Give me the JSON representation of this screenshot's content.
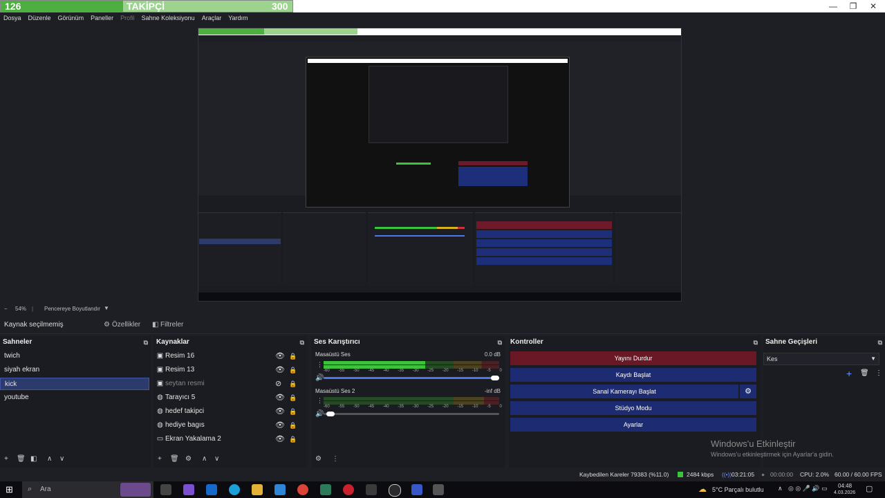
{
  "titlebar": {
    "follower_count": "126",
    "follower_label": "TAKİPÇİ",
    "follower_goal": "300",
    "follower_progress": 0.42,
    "minimize": "—",
    "maximize": "❐",
    "close": "✕"
  },
  "menu": [
    "Dosya",
    "Düzenle",
    "Görünüm",
    "Paneller",
    "Profil",
    "Sahne Koleksiyonu",
    "Araçlar",
    "Yardım"
  ],
  "zoom": {
    "minus": "−",
    "percent": "54%",
    "mode": "Pencereye Boyutlandır"
  },
  "source_toolbar": {
    "no_source": "Kaynak seçilmemiş",
    "properties": "Özellikler",
    "filters": "Filtreler"
  },
  "scenes": {
    "title": "Sahneler",
    "items": [
      "twich",
      "siyah ekran",
      "kick",
      "youtube"
    ],
    "selected_index": 2
  },
  "sources": {
    "title": "Kaynaklar",
    "items": [
      {
        "label": "Resim 16",
        "icon": "image-icon",
        "hidden": false
      },
      {
        "label": "Resim 13",
        "icon": "image-icon",
        "hidden": false
      },
      {
        "label": "seytan resmi",
        "icon": "image-icon",
        "hidden": true
      },
      {
        "label": "Tarayıcı 5",
        "icon": "globe-icon",
        "hidden": false
      },
      {
        "label": "hedef takipci",
        "icon": "globe-icon",
        "hidden": false
      },
      {
        "label": "hediye bagıs",
        "icon": "globe-icon",
        "hidden": false
      },
      {
        "label": "Ekran Yakalama 2",
        "icon": "monitor-icon",
        "hidden": false
      }
    ]
  },
  "mixer": {
    "title": "Ses Karıştırıcı",
    "tracks": [
      {
        "name": "Masaüstü Ses",
        "db": "0.0 dB",
        "level": 0.58
      },
      {
        "name": "Masaüstü Ses 2",
        "db": "-inf dB",
        "level": 0.0
      }
    ],
    "ticks": [
      "-60",
      "-55",
      "-50",
      "-45",
      "-40",
      "-35",
      "-30",
      "-25",
      "-20",
      "-15",
      "-10",
      "-5",
      "0"
    ]
  },
  "controls": {
    "title": "Kontroller",
    "stop_stream": "Yayını Durdur",
    "start_recording": "Kaydı Başlat",
    "start_virtual_cam": "Sanal Kamerayı Başlat",
    "studio_mode": "Stüdyo Modu",
    "settings": "Ayarlar"
  },
  "transitions": {
    "title": "Sahne Geçişleri",
    "selected": "Kes"
  },
  "watermark": {
    "line1": "Windows'u Etkinleştir",
    "line2": "Windows'u etkinleştirmek için Ayarlar'a gidin."
  },
  "status": {
    "dropped_frames": "Kaybedilen Kareler 79383 (%11.0)",
    "bitrate": "2484 kbps",
    "stream_time": "03:21:05",
    "record_time": "00:00:00",
    "cpu": "CPU: 2.0%",
    "fps": "60.00 / 60.00 FPS"
  },
  "taskbar": {
    "search_placeholder": "Ara",
    "weather": "5°C  Parçalı bulutlu",
    "time": "04:48",
    "date": "4.03.2026"
  },
  "colors": {
    "accent_blue": "#1c2b72",
    "stop_red": "#6b1826",
    "follower_green": "#4caf3f"
  }
}
